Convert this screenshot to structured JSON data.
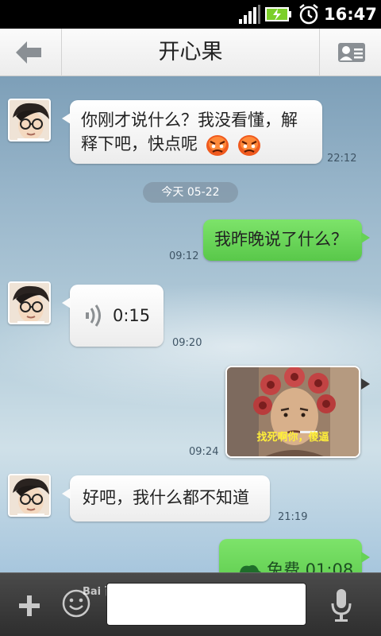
{
  "status_bar": {
    "time": "16:47",
    "icons": [
      "signal-icon",
      "battery-charging-icon",
      "alarm-icon"
    ]
  },
  "header": {
    "title": "开心果",
    "back_icon": "back-arrow-icon",
    "profile_icon": "contact-card-icon"
  },
  "messages": [
    {
      "direction": "in",
      "type": "text",
      "text": "你刚才说什么？我没看懂，解",
      "text2": "释下吧，快点呢",
      "emoji": [
        "angry-face-icon",
        "angry-face-icon"
      ],
      "time": "22:12"
    },
    {
      "type": "date",
      "text": "今天 05-22"
    },
    {
      "direction": "out",
      "type": "text",
      "text": "我昨晚说了什么？",
      "time": "09:12"
    },
    {
      "direction": "in",
      "type": "voice",
      "duration": "0:15",
      "time": "09:20"
    },
    {
      "direction": "out",
      "type": "image",
      "caption": "找死啊你，傻逼",
      "time": "09:24"
    },
    {
      "direction": "in",
      "type": "text",
      "text": "好吧，我什么都不知道",
      "time": "21:19"
    },
    {
      "direction": "out",
      "type": "call",
      "text": "免费 01:08"
    }
  ],
  "input_bar": {
    "placeholder": "",
    "watermark": "Bai 百科"
  },
  "colors": {
    "outgoing": "#62d052",
    "incoming": "#ffffff",
    "titlebar": "#f2f2f2",
    "inputbar": "#3b3b3b"
  }
}
